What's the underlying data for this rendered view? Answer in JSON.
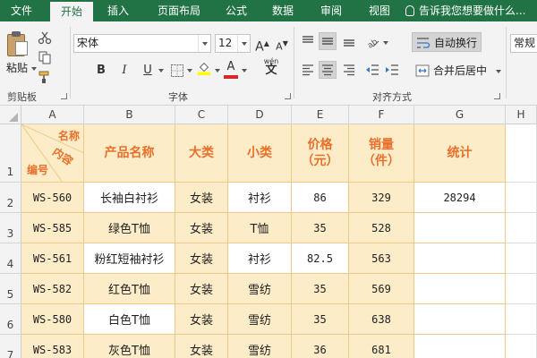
{
  "menu": {
    "tabs": [
      "文件",
      "开始",
      "插入",
      "页面布局",
      "公式",
      "数据",
      "审阅",
      "视图"
    ],
    "tell_me": "告诉我您想要做什么..."
  },
  "ribbon": {
    "paste_label": "粘贴",
    "clipboard_label": "剪贴板",
    "font_label": "字体",
    "align_label": "对齐方式",
    "font_name": "宋体",
    "font_size": "12",
    "bold": "B",
    "italic": "I",
    "underline": "U",
    "grow": "A",
    "shrink": "A",
    "font_color_letter": "A",
    "phonetic": "wén",
    "wrap_text": "自动换行",
    "merge_center": "合并后居中",
    "number_format": "常规"
  },
  "sheet": {
    "columns": [
      "A",
      "B",
      "C",
      "D",
      "E",
      "F",
      "G",
      "H"
    ],
    "rows": [
      "1",
      "2",
      "3",
      "4",
      "5",
      "6",
      "7"
    ],
    "header_diag": {
      "top": "名称",
      "mid": "内容",
      "bottom": "编号"
    },
    "header": [
      "产品名称",
      "大类",
      "小类",
      "价格\n（元）",
      "销量\n（件）",
      "统计"
    ],
    "data": [
      [
        "WS-560",
        "长袖白衬衫",
        "女装",
        "衬衫",
        "86",
        "329",
        "28294"
      ],
      [
        "WS-585",
        "绿色T恤",
        "女装",
        "T恤",
        "35",
        "528",
        ""
      ],
      [
        "WS-561",
        "粉红短袖衬衫",
        "女装",
        "衬衫",
        "82.5",
        "563",
        ""
      ],
      [
        "WS-582",
        "红色T恤",
        "女装",
        "雪纺",
        "35",
        "569",
        ""
      ],
      [
        "WS-580",
        "白色T恤",
        "女装",
        "雪纺",
        "35",
        "638",
        ""
      ],
      [
        "WS-583",
        "灰色T恤",
        "女装",
        "雪纺",
        "36",
        "681",
        ""
      ]
    ]
  },
  "colors": {
    "accent": "#217346",
    "header_fill": "#fdecc8",
    "header_text": "#e8702a",
    "font_red": "#d9262a",
    "fill_yellow": "#ffff00"
  }
}
